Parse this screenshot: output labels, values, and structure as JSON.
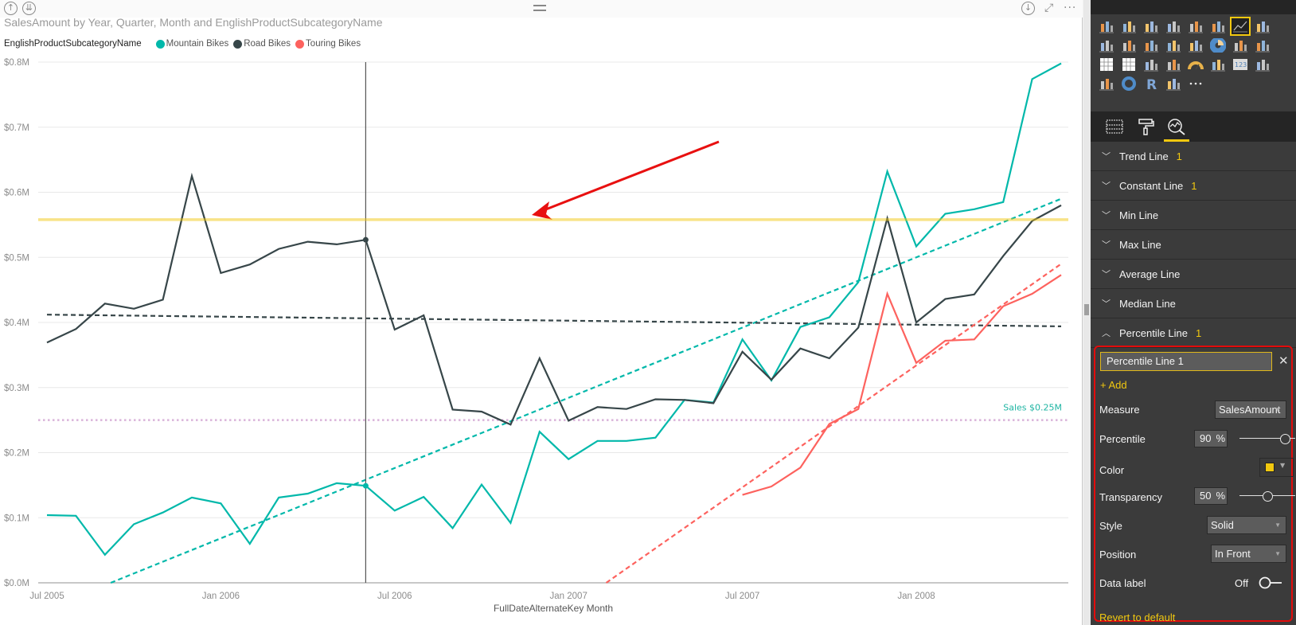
{
  "card": {
    "title": "SalesAmount by Year, Quarter, Month and EnglishProductSubcategoryName",
    "icons": {
      "drill_up": "↑",
      "drill_down": "⇊",
      "download": "↓",
      "focus": "⤢",
      "more": "···"
    }
  },
  "legend": {
    "title": "EnglishProductSubcategoryName",
    "items": [
      {
        "label": "Mountain Bikes",
        "color": "#01b8aa"
      },
      {
        "label": "Road Bikes",
        "color": "#374649"
      },
      {
        "label": "Touring Bikes",
        "color": "#fd625e"
      }
    ]
  },
  "chart_data": {
    "type": "line",
    "title": "SalesAmount by Year, Quarter, Month and EnglishProductSubcategoryName",
    "xlabel": "FullDateAlternateKey Month",
    "ylabel": "",
    "ylim": [
      0,
      0.8
    ],
    "y_unit": "$M",
    "grid": true,
    "legend_position": "top-left",
    "y_ticks": [
      "$0.0M",
      "$0.1M",
      "$0.2M",
      "$0.3M",
      "$0.4M",
      "$0.5M",
      "$0.6M",
      "$0.7M",
      "$0.8M"
    ],
    "x_tick_labels": [
      {
        "label": "Jul 2005",
        "index": 0
      },
      {
        "label": "Jan 2006",
        "index": 6
      },
      {
        "label": "Jul 2006",
        "index": 12
      },
      {
        "label": "Jan 2007",
        "index": 18
      },
      {
        "label": "Jul 2007",
        "index": 24
      },
      {
        "label": "Jan 2008",
        "index": 30
      }
    ],
    "x": [
      "Jul 2005",
      "Aug 2005",
      "Sep 2005",
      "Oct 2005",
      "Nov 2005",
      "Dec 2005",
      "Jan 2006",
      "Feb 2006",
      "Mar 2006",
      "Apr 2006",
      "May 2006",
      "Jun 2006",
      "Jul 2006",
      "Aug 2006",
      "Sep 2006",
      "Oct 2006",
      "Nov 2006",
      "Dec 2006",
      "Jan 2007",
      "Feb 2007",
      "Mar 2007",
      "Apr 2007",
      "May 2007",
      "Jun 2007",
      "Jul 2007",
      "Aug 2007",
      "Sep 2007",
      "Oct 2007",
      "Nov 2007",
      "Dec 2007",
      "Jan 2008",
      "Feb 2008",
      "Mar 2008",
      "Apr 2008",
      "May 2008",
      "Jun 2008"
    ],
    "series": [
      {
        "name": "Mountain Bikes",
        "color": "#01b8aa",
        "values": [
          0.104,
          0.103,
          0.043,
          0.09,
          0.108,
          0.131,
          0.122,
          0.06,
          0.131,
          0.137,
          0.153,
          0.149,
          0.111,
          0.132,
          0.084,
          0.151,
          0.092,
          0.232,
          0.19,
          0.218,
          0.218,
          0.223,
          0.281,
          0.277,
          0.374,
          0.311,
          0.393,
          0.408,
          0.462,
          0.632,
          0.517,
          0.567,
          0.574,
          0.585,
          0.774,
          0.798
        ]
      },
      {
        "name": "Road Bikes",
        "color": "#374649",
        "values": [
          0.369,
          0.39,
          0.429,
          0.421,
          0.435,
          0.625,
          0.476,
          0.489,
          0.513,
          0.524,
          0.52,
          0.527,
          0.389,
          0.411,
          0.266,
          0.263,
          0.243,
          0.345,
          0.249,
          0.27,
          0.267,
          0.282,
          0.281,
          0.276,
          0.355,
          0.312,
          0.36,
          0.345,
          0.392,
          0.56,
          0.4,
          0.436,
          0.443,
          0.502,
          0.556,
          0.58
        ]
      },
      {
        "name": "Touring Bikes",
        "color": "#fd625e",
        "values": [
          null,
          null,
          null,
          null,
          null,
          null,
          null,
          null,
          null,
          null,
          null,
          null,
          null,
          null,
          null,
          null,
          null,
          null,
          null,
          null,
          null,
          null,
          null,
          null,
          0.135,
          0.148,
          0.177,
          0.244,
          0.267,
          0.444,
          0.338,
          0.372,
          0.374,
          0.425,
          0.444,
          0.473
        ]
      }
    ],
    "trend_lines": [
      {
        "series": "Mountain Bikes",
        "color": "#01b8aa",
        "start": {
          "index": 2.2,
          "value": 0.0
        },
        "end": {
          "index": 35,
          "value": 0.59
        }
      },
      {
        "series": "Road Bikes",
        "color": "#374649",
        "start": {
          "index": 0,
          "value": 0.412
        },
        "end": {
          "index": 35,
          "value": 0.394
        }
      },
      {
        "series": "Touring Bikes",
        "color": "#fd625e",
        "start": {
          "index": 19.3,
          "value": 0.0
        },
        "end": {
          "index": 35,
          "value": 0.49
        }
      }
    ],
    "constant_line": {
      "value": 0.25,
      "color": "#d9b3d9",
      "label": "Sales $0.25M",
      "label_color": "#1fb5a3"
    },
    "percentile_line": {
      "value": 0.558,
      "percentile": 90,
      "color": "#f2c80f",
      "transparency": 50
    },
    "hover": {
      "index": 11,
      "label": "Jun 2006"
    }
  },
  "pane": {
    "visualizations": [
      "stacked-bar",
      "stacked-column",
      "clustered-bar",
      "clustered-column",
      "100-stacked-bar",
      "100-stacked-column",
      "line",
      "area",
      "stacked-area",
      "line-and-stacked-column",
      "line-and-clustered-column",
      "ribbon",
      "scatter",
      "pie",
      "treemap",
      "map",
      "table",
      "matrix",
      "filled-map",
      "funnel",
      "gauge",
      "multi-row-card",
      "card",
      "kpi",
      "slicer",
      "donut",
      "r-script",
      "shape-map",
      "more"
    ],
    "selected_visualization": "line",
    "tabs": [
      {
        "name": "fields",
        "icon": "fields-icon"
      },
      {
        "name": "format",
        "icon": "paint-roller-icon"
      },
      {
        "name": "analytics",
        "icon": "analytics-icon",
        "active": true
      }
    ],
    "sections": [
      {
        "label": "Trend Line",
        "count": "1",
        "expanded": false
      },
      {
        "label": "Constant Line",
        "count": "1",
        "expanded": false
      },
      {
        "label": "Min Line",
        "count": "",
        "expanded": false
      },
      {
        "label": "Max Line",
        "count": "",
        "expanded": false
      },
      {
        "label": "Average Line",
        "count": "",
        "expanded": false
      },
      {
        "label": "Median Line",
        "count": "",
        "expanded": false
      },
      {
        "label": "Percentile Line",
        "count": "1",
        "expanded": true
      }
    ],
    "percentile_line": {
      "name": "Percentile Line 1",
      "add_label": "+ Add",
      "measure_label": "Measure",
      "measure_value": "SalesAmount",
      "percentile_label": "Percentile",
      "percentile_value": "90",
      "percentile_fraction": 0.9,
      "percent_sign": "%",
      "color_label": "Color",
      "color_value": "#f2c80f",
      "transparency_label": "Transparency",
      "transparency_value": "50",
      "transparency_fraction": 0.5,
      "style_label": "Style",
      "style_value": "Solid",
      "position_label": "Position",
      "position_value": "In Front",
      "data_label_label": "Data label",
      "data_label_value": "Off",
      "revert_label": "Revert to default"
    }
  }
}
